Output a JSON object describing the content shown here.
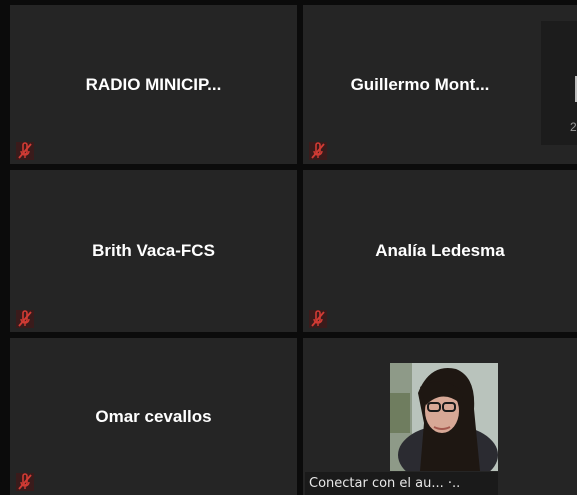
{
  "participants": [
    {
      "name": "RADIO MINICIP...",
      "mic": "muted-mic-icon"
    },
    {
      "name": "Guillermo  Mont...",
      "mic": "muted-mic-icon"
    },
    {
      "name": "Brith Vaca-FCS",
      "mic": "muted-mic-icon"
    },
    {
      "name": "Analía Ledesma",
      "mic": "muted-mic-icon"
    },
    {
      "name": "Omar cevallos",
      "mic": "muted-mic-icon"
    }
  ],
  "video_participant": {
    "caption": "Conectar con el au... ·.."
  },
  "side_panel": {
    "number": "2"
  },
  "colors": {
    "tile_bg": "#252525",
    "mic_muted": "#c4302b",
    "page_bg": "#0b0b0b"
  }
}
